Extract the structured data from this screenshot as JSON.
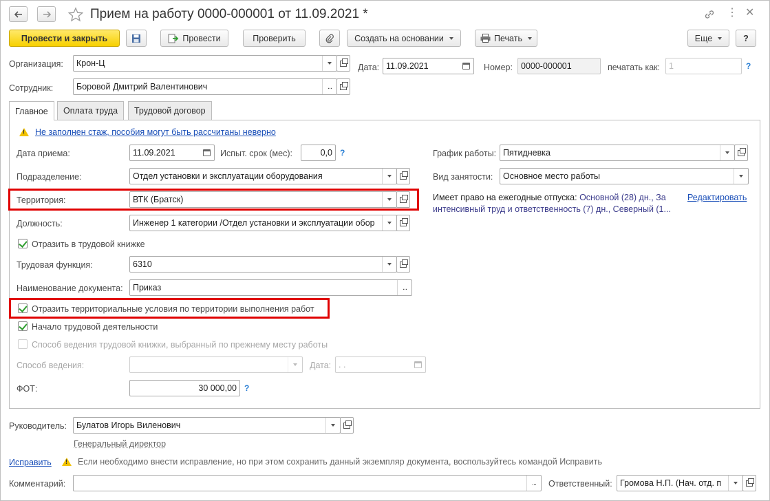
{
  "window": {
    "title": "Прием на работу 0000-000001 от 11.09.2021 *"
  },
  "toolbar": {
    "post_close": "Провести и закрыть",
    "post": "Провести",
    "check": "Проверить",
    "create_based": "Создать на основании",
    "print": "Печать",
    "more": "Еще",
    "help": "?"
  },
  "header": {
    "org_label": "Организация:",
    "org_value": "Крон-Ц",
    "date_label": "Дата:",
    "date_value": "11.09.2021",
    "number_label": "Номер:",
    "number_value": "0000-000001",
    "print_as_label": "печатать как:",
    "print_as_value": "1",
    "employee_label": "Сотрудник:",
    "employee_value": "Боровой Дмитрий Валентинович"
  },
  "tabs": [
    "Главное",
    "Оплата труда",
    "Трудовой договор"
  ],
  "main": {
    "warning_text": "Не заполнен стаж, пособия могут быть рассчитаны неверно",
    "hire_date_label": "Дата приема:",
    "hire_date_value": "11.09.2021",
    "probation_label": "Испыт. срок (мес):",
    "probation_value": "0,0",
    "department_label": "Подразделение:",
    "department_value": "Отдел установки и эксплуатации оборудования",
    "territory_label": "Территория:",
    "territory_value": "ВТК (Братск)",
    "position_label": "Должность:",
    "position_value": "Инженер 1 категории /Отдел установки и эксплуатации обор",
    "workbook_check": "Отразить в трудовой книжке",
    "labor_function_label": "Трудовая функция:",
    "labor_function_value": "6310",
    "doc_name_label": "Наименование документа:",
    "doc_name_value": "Приказ",
    "territorial_check": "Отразить территориальные условия по территории выполнения работ",
    "labor_start_check": "Начало трудовой деятельности",
    "book_method_check": "Способ ведения трудовой книжки, выбранный по прежнему месту работы",
    "method_label": "Способ ведения:",
    "method_date_label": "Дата:",
    "method_date_value": " .  .",
    "fot_label": "ФОТ:",
    "fot_value": "30 000,00",
    "schedule_label": "График работы:",
    "schedule_value": "Пятидневка",
    "employment_label": "Вид занятости:",
    "employment_value": "Основное место работы",
    "vacation_prefix": "Имеет право на ежегодные отпуска:",
    "vacation_line1": "Основной (28) дн., За",
    "vacation_line2": "интенсивный труд и ответственность (7) дн., Северный (1...",
    "vacation_edit": "Редактировать"
  },
  "footer": {
    "manager_label": "Руководитель:",
    "manager_value": "Булатов Игорь Виленович",
    "manager_position": "Генеральный директор",
    "fix_link": "Исправить",
    "fix_note": "Если необходимо внести исправление, но при этом сохранить данный экземпляр документа, воспользуйтесь командой Исправить",
    "comment_label": "Комментарий:",
    "comment_value": "",
    "responsible_label": "Ответственный:",
    "responsible_value": "Громова Н.П. (Нач. отд. п"
  },
  "colors": {
    "accent_yellow": "#f7d000",
    "highlight_red": "#e00000",
    "link_blue": "#1a4fb8",
    "check_green": "#2f9e2f"
  }
}
